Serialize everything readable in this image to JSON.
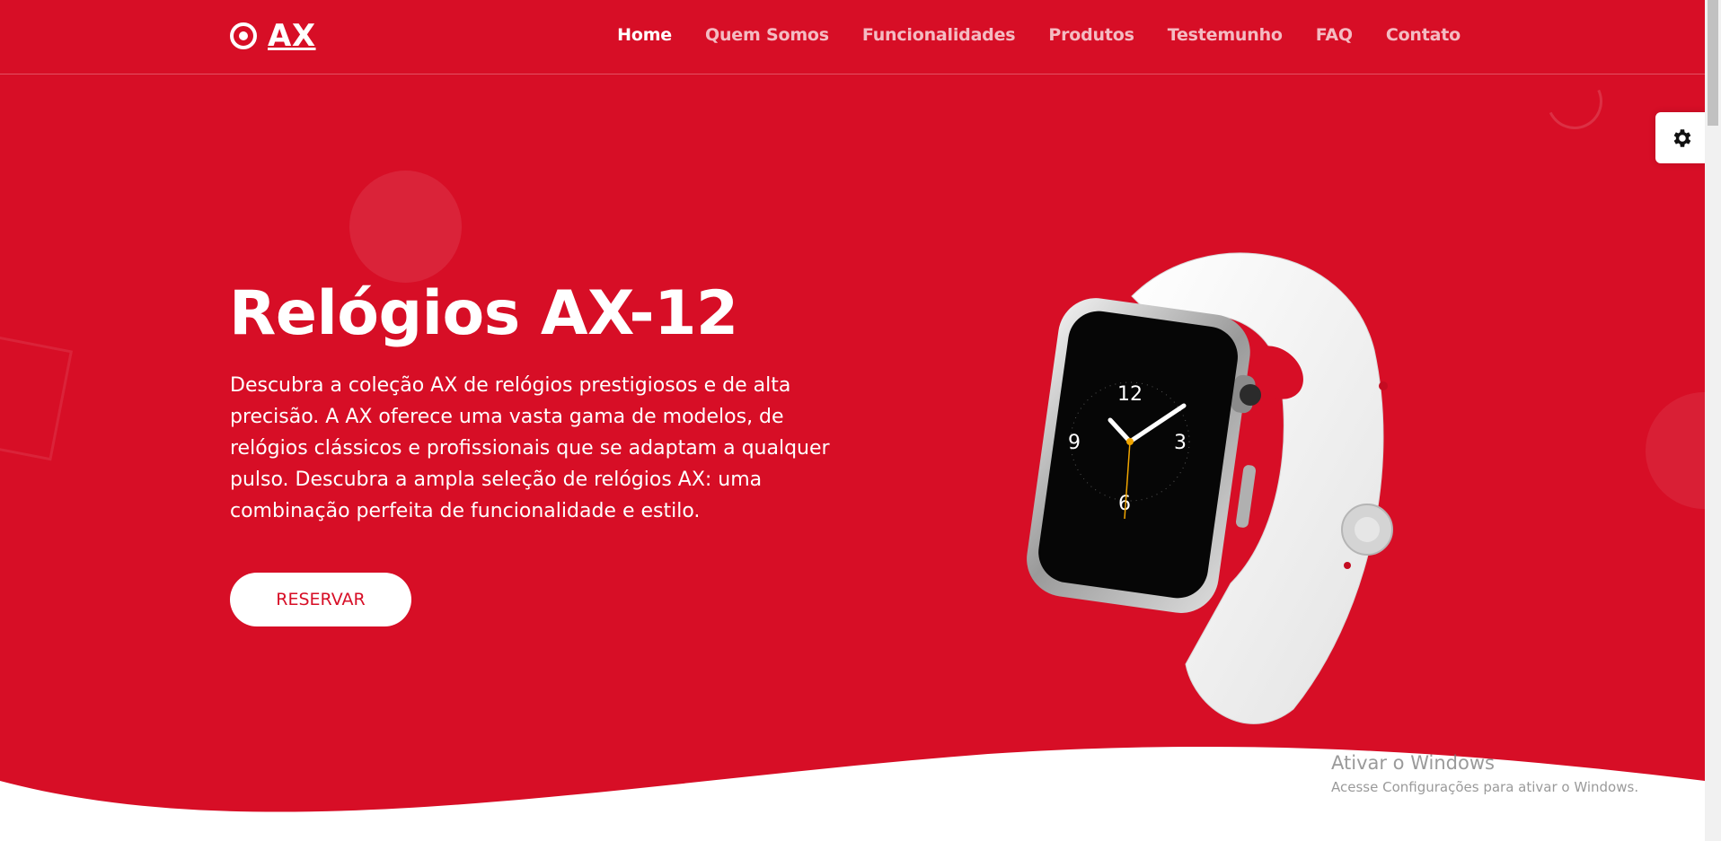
{
  "brand": {
    "name": "AX",
    "color": "#d70e26"
  },
  "nav": {
    "items": [
      {
        "label": "Home",
        "active": true
      },
      {
        "label": "Quem Somos",
        "active": false
      },
      {
        "label": "Funcionalidades",
        "active": false
      },
      {
        "label": "Produtos",
        "active": false
      },
      {
        "label": "Testemunho",
        "active": false
      },
      {
        "label": "FAQ",
        "active": false
      },
      {
        "label": "Contato",
        "active": false
      }
    ]
  },
  "hero": {
    "title": "Relógios AX-12",
    "description": "Descubra a coleção AX de relógios prestigiosos e de alta precisão. A AX oferece uma vasta gama de modelos, de relógios clássicos e profissionais que se adaptam a qualquer pulso. Descubra a ampla seleção de relógios AX: uma combinação perfeita de funcionalidade e estilo.",
    "cta_label": "RESERVAR"
  },
  "watch": {
    "dial_numbers": [
      "12",
      "3",
      "6",
      "9"
    ]
  },
  "icons": {
    "settings": "gear-icon",
    "logo": "target-icon"
  },
  "watermark": {
    "title": "Ativar o Windows",
    "subtitle": "Acesse Configurações para ativar o Windows."
  }
}
